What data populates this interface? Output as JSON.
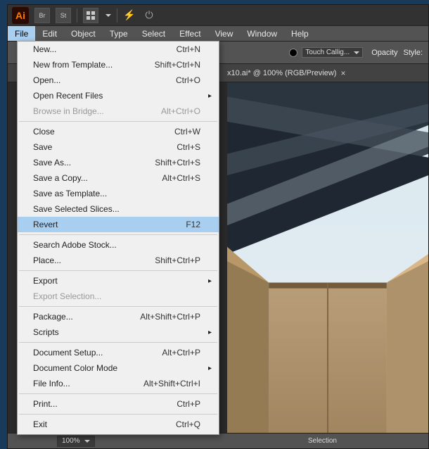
{
  "titlebar": {
    "logo": "Ai",
    "icons": [
      "Br",
      "St"
    ]
  },
  "menubar": {
    "items": [
      "File",
      "Edit",
      "Object",
      "Type",
      "Select",
      "Effect",
      "View",
      "Window",
      "Help"
    ],
    "active_index": 0
  },
  "toolbar2": {
    "preset_label": "Touch Callig...",
    "opacity_label": "Opacity",
    "style_label": "Style:"
  },
  "doc_tab": {
    "label": "x10.ai* @ 100% (RGB/Preview)"
  },
  "statusbar": {
    "zoom": "100%",
    "mode": "Selection"
  },
  "file_menu": [
    {
      "label": "New...",
      "shortcut": "Ctrl+N"
    },
    {
      "label": "New from Template...",
      "shortcut": "Shift+Ctrl+N"
    },
    {
      "label": "Open...",
      "shortcut": "Ctrl+O"
    },
    {
      "label": "Open Recent Files",
      "submenu": true
    },
    {
      "label": "Browse in Bridge...",
      "shortcut": "Alt+Ctrl+O",
      "disabled": true
    },
    {
      "sep": true
    },
    {
      "label": "Close",
      "shortcut": "Ctrl+W"
    },
    {
      "label": "Save",
      "shortcut": "Ctrl+S"
    },
    {
      "label": "Save As...",
      "shortcut": "Shift+Ctrl+S"
    },
    {
      "label": "Save a Copy...",
      "shortcut": "Alt+Ctrl+S"
    },
    {
      "label": "Save as Template..."
    },
    {
      "label": "Save Selected Slices..."
    },
    {
      "label": "Revert",
      "shortcut": "F12",
      "highlighted": true
    },
    {
      "sep": true
    },
    {
      "label": "Search Adobe Stock..."
    },
    {
      "label": "Place...",
      "shortcut": "Shift+Ctrl+P"
    },
    {
      "sep": true
    },
    {
      "label": "Export",
      "submenu": true
    },
    {
      "label": "Export Selection...",
      "disabled": true
    },
    {
      "sep": true
    },
    {
      "label": "Package...",
      "shortcut": "Alt+Shift+Ctrl+P"
    },
    {
      "label": "Scripts",
      "submenu": true
    },
    {
      "sep": true
    },
    {
      "label": "Document Setup...",
      "shortcut": "Alt+Ctrl+P"
    },
    {
      "label": "Document Color Mode",
      "submenu": true
    },
    {
      "label": "File Info...",
      "shortcut": "Alt+Shift+Ctrl+I"
    },
    {
      "sep": true
    },
    {
      "label": "Print...",
      "shortcut": "Ctrl+P"
    },
    {
      "sep": true
    },
    {
      "label": "Exit",
      "shortcut": "Ctrl+Q"
    }
  ]
}
